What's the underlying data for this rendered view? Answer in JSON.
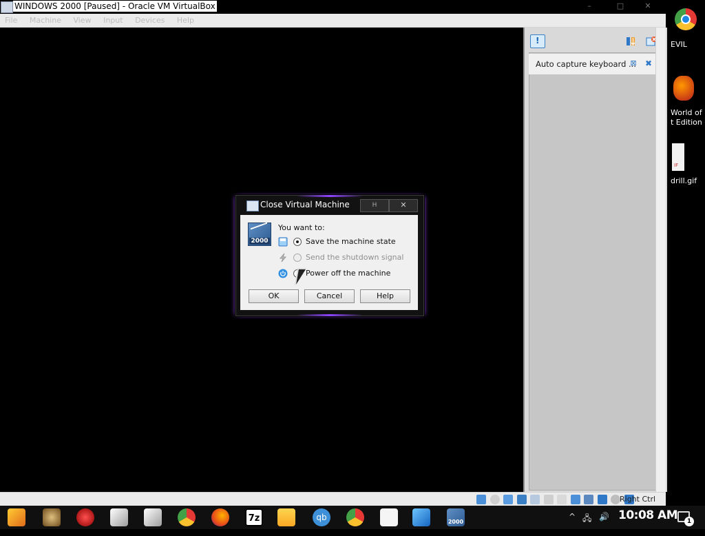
{
  "window": {
    "title": "WINDOWS 2000 [Paused] - Oracle VM VirtualBox",
    "controls": {
      "minimize": "–",
      "maximize": "□",
      "close": "✕"
    }
  },
  "menubar": {
    "items": [
      "File",
      "Machine",
      "View",
      "Input",
      "Devices",
      "Help"
    ]
  },
  "notification_panel": {
    "message": "Auto capture keyboard ...",
    "icons": [
      "info-icon",
      "sort-icon",
      "close-all-icon",
      "mute-icon",
      "close-icon"
    ]
  },
  "dialog": {
    "title": "Close Virtual Machine",
    "help_glyph": "H",
    "close_glyph": "✕",
    "icon_label": "2000",
    "prompt": "You want to:",
    "options": [
      {
        "label": "Save the machine state",
        "checked": true,
        "enabled": true,
        "icon": "save-state-icon"
      },
      {
        "label": "Send the shutdown signal",
        "checked": false,
        "enabled": false,
        "icon": "acpi-shutdown-icon"
      },
      {
        "label": "Power off the machine",
        "checked": false,
        "enabled": true,
        "icon": "power-off-icon"
      }
    ],
    "buttons": {
      "ok": "OK",
      "cancel": "Cancel",
      "help": "Help"
    }
  },
  "statusbar": {
    "host_key": "Right Ctrl"
  },
  "desktop": {
    "labels": [
      "EVIL",
      "World of",
      "t Edition",
      "drill.gif"
    ]
  },
  "taskbar": {
    "apps": [
      "start-menu-icon",
      "app-icon",
      "app-icon",
      "app-icon",
      "app-icon",
      "chrome-icon",
      "firefox-icon",
      "7zip-icon",
      "file-explorer-icon",
      "qbittorrent-icon",
      "chrome-icon",
      "app-icon",
      "virtualbox-icon",
      "vm-window-icon"
    ],
    "seven_zip_label": "7z",
    "qb_label": "qb",
    "vm_label": "2000",
    "tray": {
      "chevron": "^",
      "network": "🖧",
      "volume": "🔊"
    },
    "clock": "10:08 AM",
    "notification_count": "1"
  },
  "colors": {
    "dialog_frame": "#121212",
    "dialog_glow": "#8e44ff",
    "accent_blue": "#1e6fd0"
  }
}
